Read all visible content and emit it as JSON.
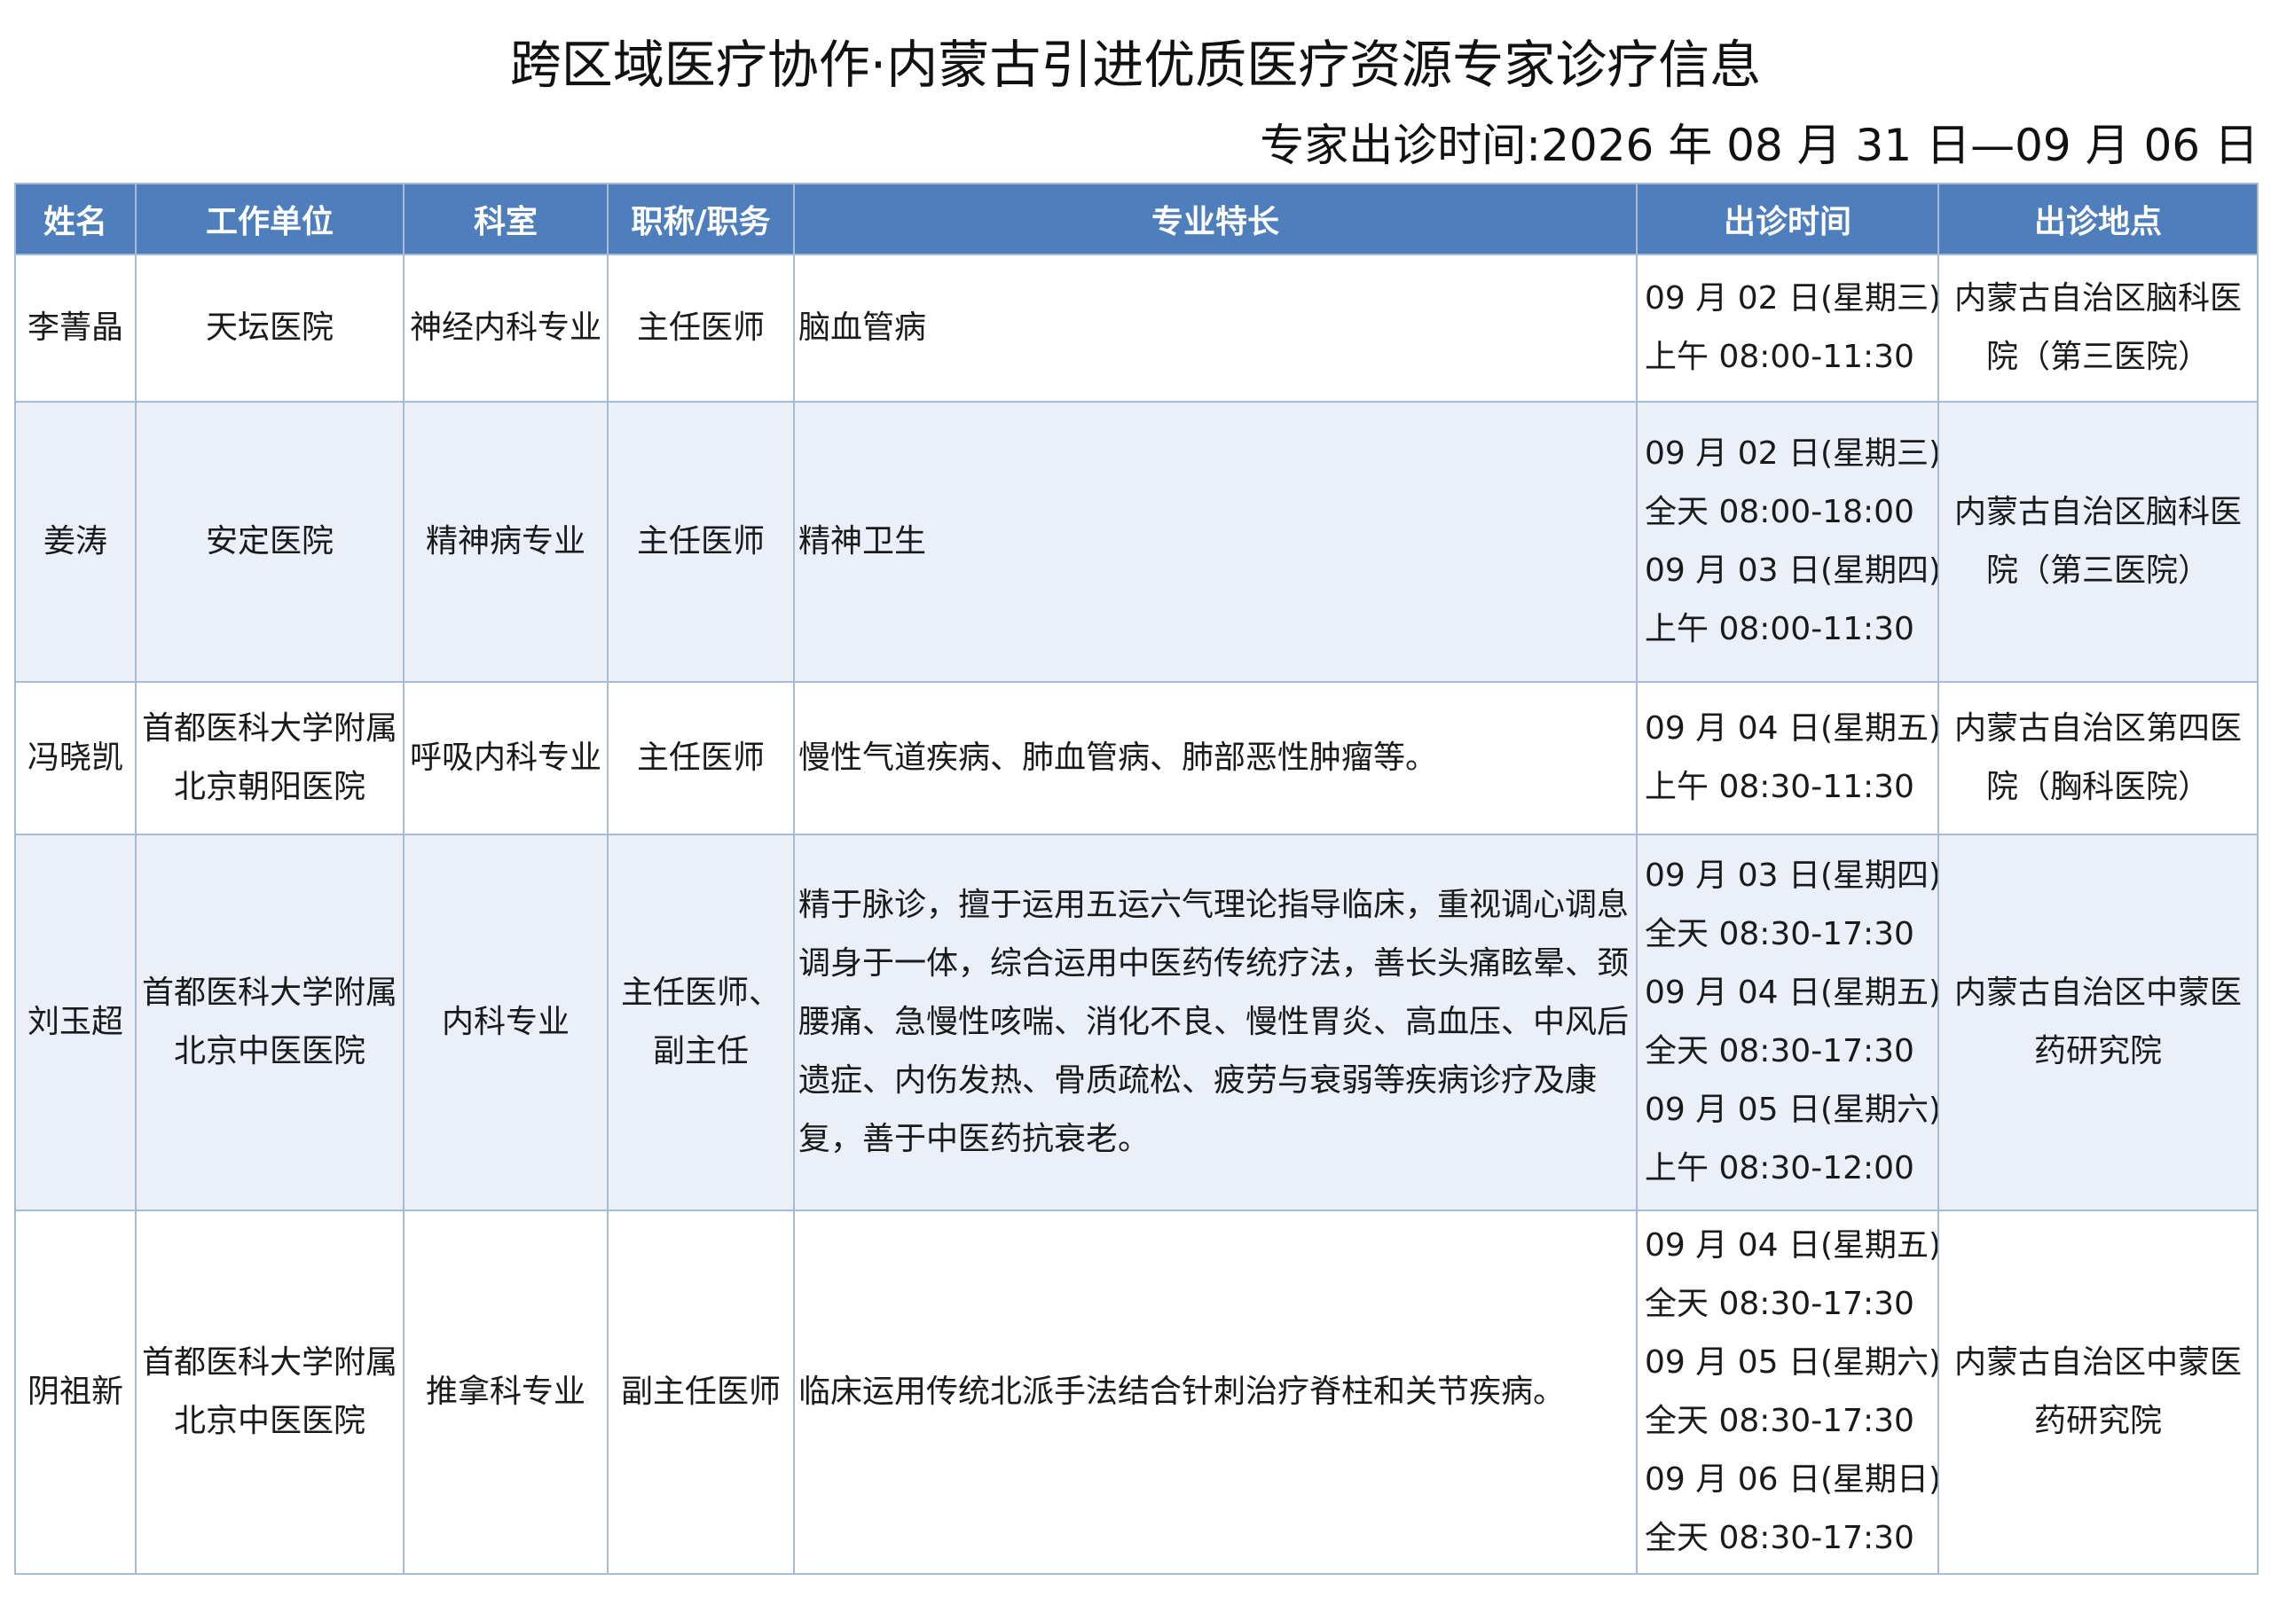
{
  "title": "跨区域医疗协作·内蒙古引进优质医疗资源专家诊疗信息",
  "subtitle": "专家出诊时间:2026 年 08 月 31 日—09 月 06 日",
  "columns": {
    "name": "姓名",
    "hospital": "工作单位",
    "department": "科室",
    "title": "职称/职务",
    "specialty": "专业特长",
    "schedule": "出诊时间",
    "location": "出诊地点"
  },
  "rows": [
    {
      "name": "李菁晶",
      "hospital": [
        "天坛医院"
      ],
      "department": "神经内科专业",
      "title": [
        "主任医师"
      ],
      "specialty": "脑血管病",
      "schedule": [
        "09 月 02 日(星期三)",
        "上午 08:00-11:30"
      ],
      "location": [
        "内蒙古自治区脑科医",
        "院（第三医院）"
      ]
    },
    {
      "name": "姜涛",
      "hospital": [
        "安定医院"
      ],
      "department": "精神病专业",
      "title": [
        "主任医师"
      ],
      "specialty": "精神卫生",
      "schedule": [
        "09 月 02 日(星期三)",
        "全天 08:00-18:00",
        "09 月 03 日(星期四)",
        "上午 08:00-11:30"
      ],
      "location": [
        "内蒙古自治区脑科医",
        "院（第三医院）"
      ]
    },
    {
      "name": "冯晓凯",
      "hospital": [
        "首都医科大学附属",
        "北京朝阳医院"
      ],
      "department": "呼吸内科专业",
      "title": [
        "主任医师"
      ],
      "specialty": "慢性气道疾病、肺血管病、肺部恶性肿瘤等。",
      "schedule": [
        "09 月 04 日(星期五)",
        "上午 08:30-11:30"
      ],
      "location": [
        "内蒙古自治区第四医",
        "院（胸科医院）"
      ]
    },
    {
      "name": "刘玉超",
      "hospital": [
        "首都医科大学附属",
        "北京中医医院"
      ],
      "department": "内科专业",
      "title": [
        "主任医师、",
        "副主任"
      ],
      "specialty": "精于脉诊，擅于运用五运六气理论指导临床，重视调心调息调身于一体，综合运用中医药传统疗法，善长头痛眩晕、颈腰痛、急慢性咳喘、消化不良、慢性胃炎、高血压、中风后遗症、内伤发热、骨质疏松、疲劳与衰弱等疾病诊疗及康复，善于中医药抗衰老。",
      "schedule": [
        "09 月 03 日(星期四)",
        "全天 08:30-17:30",
        "09 月 04 日(星期五)",
        "全天 08:30-17:30",
        "09 月 05 日(星期六)",
        "上午 08:30-12:00"
      ],
      "location": [
        "内蒙古自治区中蒙医",
        "药研究院"
      ]
    },
    {
      "name": "阴祖新",
      "hospital": [
        "首都医科大学附属",
        "北京中医医院"
      ],
      "department": "推拿科专业",
      "title": [
        "副主任医师"
      ],
      "specialty": "临床运用传统北派手法结合针刺治疗脊柱和关节疾病。",
      "schedule": [
        "09 月 04 日(星期五)",
        "全天 08:30-17:30",
        "09 月 05 日(星期六)",
        "全天 08:30-17:30",
        "09 月 06 日(星期日)",
        "全天 08:30-17:30"
      ],
      "location": [
        "内蒙古自治区中蒙医",
        "药研究院"
      ]
    }
  ]
}
